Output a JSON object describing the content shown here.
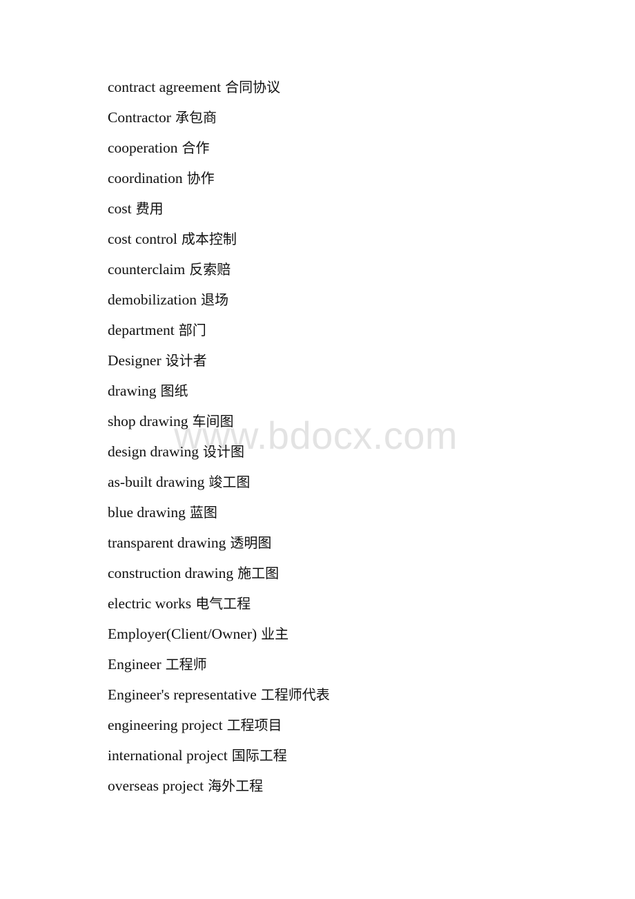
{
  "watermark": "www.bdocx.com",
  "entries": [
    {
      "en": "contract agreement",
      "zh": "合同协议"
    },
    {
      "en": "Contractor",
      "zh": "承包商"
    },
    {
      "en": "cooperation",
      "zh": "合作"
    },
    {
      "en": "coordination",
      "zh": "协作"
    },
    {
      "en": "cost",
      "zh": "费用"
    },
    {
      "en": "cost control",
      "zh": "成本控制"
    },
    {
      "en": "counterclaim",
      "zh": "反索赔"
    },
    {
      "en": "demobilization",
      "zh": "退场"
    },
    {
      "en": "department",
      "zh": "部门"
    },
    {
      "en": "Designer",
      "zh": "设计者"
    },
    {
      "en": "drawing",
      "zh": "图纸"
    },
    {
      "en": "shop drawing",
      "zh": "车间图"
    },
    {
      "en": "design drawing",
      "zh": "设计图"
    },
    {
      "en": "as-built drawing",
      "zh": "竣工图"
    },
    {
      "en": "blue drawing",
      "zh": "蓝图"
    },
    {
      "en": "transparent drawing",
      "zh": "透明图"
    },
    {
      "en": "construction drawing",
      "zh": "施工图"
    },
    {
      "en": "electric works",
      "zh": "电气工程"
    },
    {
      "en": "Employer(Client/Owner)",
      "zh": "业主"
    },
    {
      "en": "Engineer",
      "zh": "工程师"
    },
    {
      "en": "Engineer's representative",
      "zh": "工程师代表"
    },
    {
      "en": "engineering project",
      "zh": "工程项目"
    },
    {
      "en": "international project",
      "zh": "国际工程"
    },
    {
      "en": "overseas project",
      "zh": "海外工程"
    }
  ]
}
